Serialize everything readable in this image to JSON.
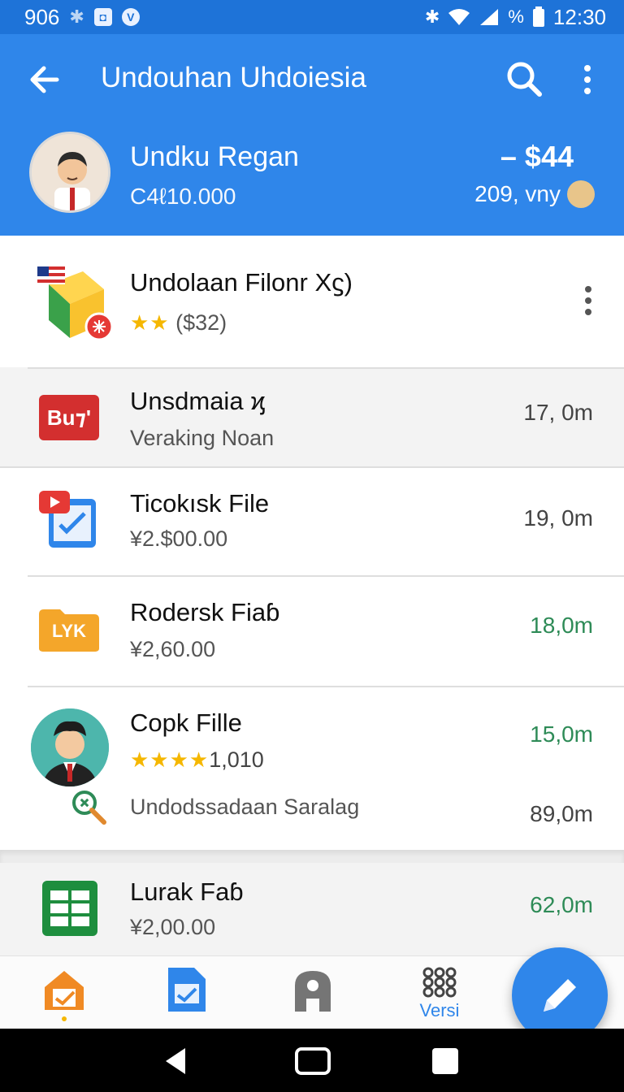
{
  "status_bar": {
    "left_text": "906",
    "time": "12:30",
    "battery": "%"
  },
  "header": {
    "title": "Undouhan Uhdoiesia"
  },
  "account": {
    "name": "Undku Regan",
    "balance": "C4ℓ10.000",
    "amount": "– $44",
    "meta": "209, vny"
  },
  "items": [
    {
      "title": "Undolaan Filonr Χϛ)",
      "stars": "★★",
      "sub": "($32)",
      "meta": "",
      "icon": "package-icon"
    },
    {
      "title": "Unsdmaia ϗ",
      "sub": "Veraking Noan",
      "meta": "17, 0m",
      "icon_text": "Bu⁊'",
      "icon": "buy-badge-icon"
    },
    {
      "title": "Ticokısk File",
      "sub": "¥2.$00.00",
      "meta": "19, 0m",
      "icon": "video-document-icon"
    },
    {
      "title": "Rodersk Fiaɓ",
      "sub": "¥2,60.00",
      "meta": "18,0m",
      "icon_text": "LYK",
      "icon": "folder-icon"
    },
    {
      "title": "Copk Fille",
      "stars": "★★★★",
      "rating": "1,010",
      "sub": "Undodssadaan Saralag",
      "meta": "15,0m",
      "meta2": "89,0m",
      "icon": "person-avatar"
    },
    {
      "title": "Lurak Faɓ",
      "sub": "¥2,00.00",
      "meta": "62,0m",
      "icon": "spreadsheet-icon"
    }
  ],
  "bottom_nav": {
    "versi_label": "Versi"
  },
  "colors": {
    "primary": "#2f86ea",
    "status": "#1e73d8",
    "green": "#2e8b57",
    "star": "#f5b700"
  }
}
